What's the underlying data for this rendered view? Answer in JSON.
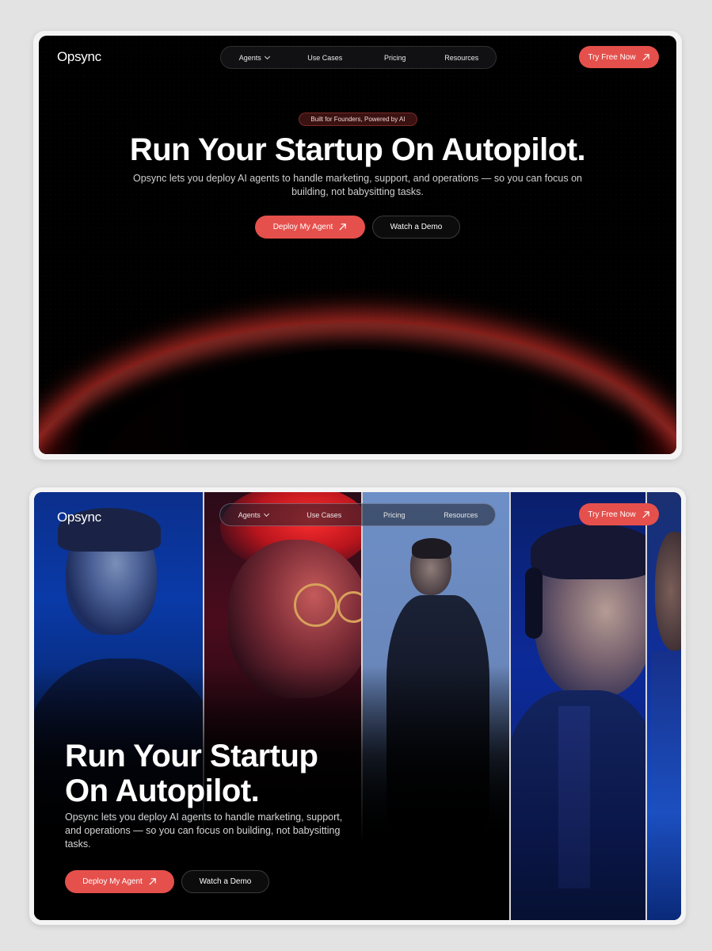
{
  "brand": {
    "name": "Opsync"
  },
  "nav": {
    "items": [
      "Agents",
      "Use Cases",
      "Pricing",
      "Resources"
    ]
  },
  "cta": {
    "try_free": "Try Free Now"
  },
  "hero": {
    "badge": "Built for Founders, Powered by AI",
    "title_line": "Run Your Startup On Autopilot.",
    "title_line1": "Run Your Startup",
    "title_line2": "On Autopilot.",
    "subtitle_v1": "Opsync lets you deploy AI agents to handle marketing, support, and operations — so you can focus on building, not babysitting tasks.",
    "subtitle_v2": "Opsync lets you deploy AI agents to handle marketing, support, and operations — so you can focus on building, not babysitting tasks.",
    "primary_button": "Deploy My Agent",
    "secondary_button": "Watch a Demo"
  },
  "colors": {
    "accent": "#e5504c",
    "background": "#000000",
    "glow": "#ff3a34"
  }
}
